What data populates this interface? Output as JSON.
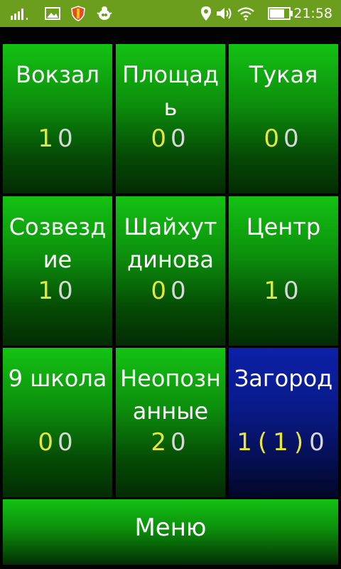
{
  "status_bar": {
    "time": "21:58",
    "icons": [
      "signal-icon",
      "image-icon",
      "shield-icon",
      "bug-icon",
      "location-icon",
      "volume-icon",
      "wifi-icon",
      "battery-icon"
    ]
  },
  "tiles": [
    {
      "name": "Вокзал",
      "count_a": "1",
      "count_b": "0",
      "color": "green"
    },
    {
      "name": "Площадь",
      "count_a": "0",
      "count_b": "0",
      "color": "green"
    },
    {
      "name": "Тукая",
      "count_a": "0",
      "count_b": "0",
      "color": "green"
    },
    {
      "name": "Созвездие",
      "count_a": "1",
      "count_b": "0",
      "color": "green"
    },
    {
      "name": "Шайхутдинова",
      "count_a": "0",
      "count_b": "0",
      "color": "green"
    },
    {
      "name": "Центр",
      "count_a": "1",
      "count_b": "0",
      "color": "green"
    },
    {
      "name": "9 школа",
      "count_a": "0",
      "count_b": "0",
      "color": "green"
    },
    {
      "name": "Неопознанные",
      "count_a": "2",
      "count_b": "0",
      "color": "green"
    },
    {
      "name": "Загород",
      "count_a": "1",
      "count_extra_open": "(",
      "count_extra": "1",
      "count_extra_close": ")",
      "count_b": "0",
      "color": "blue"
    }
  ],
  "menu": {
    "label": "Меню"
  },
  "colors": {
    "status_bar": "#6b9e1d",
    "tile_green_top": "#14c214",
    "tile_blue_top": "#0d20a8",
    "count_yellow": "#e6e63c",
    "count_white": "#d8d8d8"
  }
}
